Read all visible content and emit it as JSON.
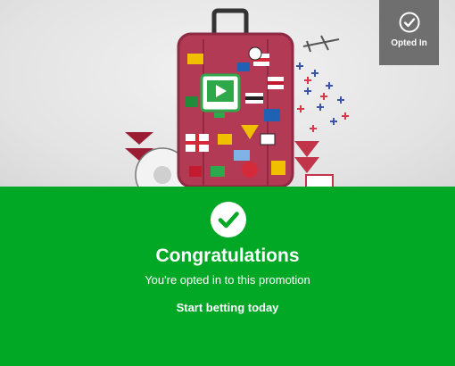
{
  "hero": {
    "image_icon": "suitcase-with-flag-stickers-illustration",
    "badge": {
      "icon": "check-circle-icon",
      "label": "Opted In"
    }
  },
  "confirmation": {
    "icon": "check-circle-icon",
    "title": "Congratulations",
    "subtitle": "You're opted in to this promotion",
    "cta_label": "Start betting today"
  },
  "colors": {
    "brand_green": "#00a826",
    "badge_gray": "#6f6f6f",
    "suitcase": "#b23a55"
  }
}
